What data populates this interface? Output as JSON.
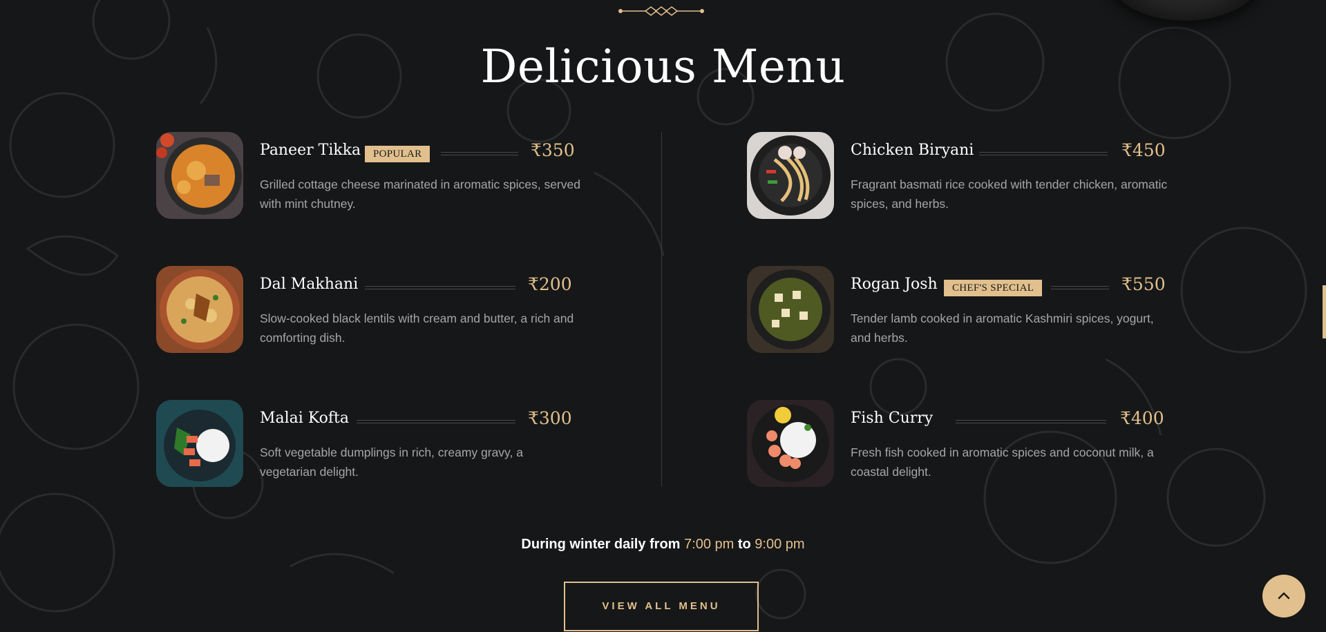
{
  "section_title": "Delicious Menu",
  "menu_items": [
    {
      "name": "Paneer Tikka",
      "badge": "POPULAR",
      "price": "₹350",
      "description": "Grilled cottage cheese marinated in aromatic spices, served with mint chutney.",
      "image": "curry-bowl-image"
    },
    {
      "name": "Chicken Biryani",
      "badge": "",
      "price": "₹450",
      "description": "Fragrant basmati rice cooked with tender chicken, aromatic spices, and herbs.",
      "image": "noodle-wok-image"
    },
    {
      "name": "Dal Makhani",
      "badge": "",
      "price": "₹200",
      "description": "Slow-cooked black lentils with cream and butter, a rich and comforting dish.",
      "image": "biryani-pot-image"
    },
    {
      "name": "Rogan Josh",
      "badge": "CHEF'S SPECIAL",
      "price": "₹550",
      "description": "Tender lamb cooked in aromatic Kashmiri spices, yogurt, and herbs.",
      "image": "palak-paneer-image"
    },
    {
      "name": "Malai Kofta",
      "badge": "",
      "price": "₹300",
      "description": "Soft vegetable dumplings in rich, creamy gravy, a vegetarian delight.",
      "image": "salmon-rice-bowl-image"
    },
    {
      "name": "Fish Curry",
      "badge": "",
      "price": "₹400",
      "description": "Fresh fish cooked in aromatic spices and coconut milk, a coastal delight.",
      "image": "shrimp-rice-plate-image"
    }
  ],
  "hours": {
    "prefix": "During winter daily from",
    "start": "7:00 pm",
    "joiner": "to",
    "end": "9:00 pm"
  },
  "view_all_button": "VIEW ALL MENU",
  "scroll_top_icon": "chevron-up-icon",
  "colors": {
    "background": "#161718",
    "accent": "#e2c08d",
    "muted_text": "#a6a6a6"
  }
}
